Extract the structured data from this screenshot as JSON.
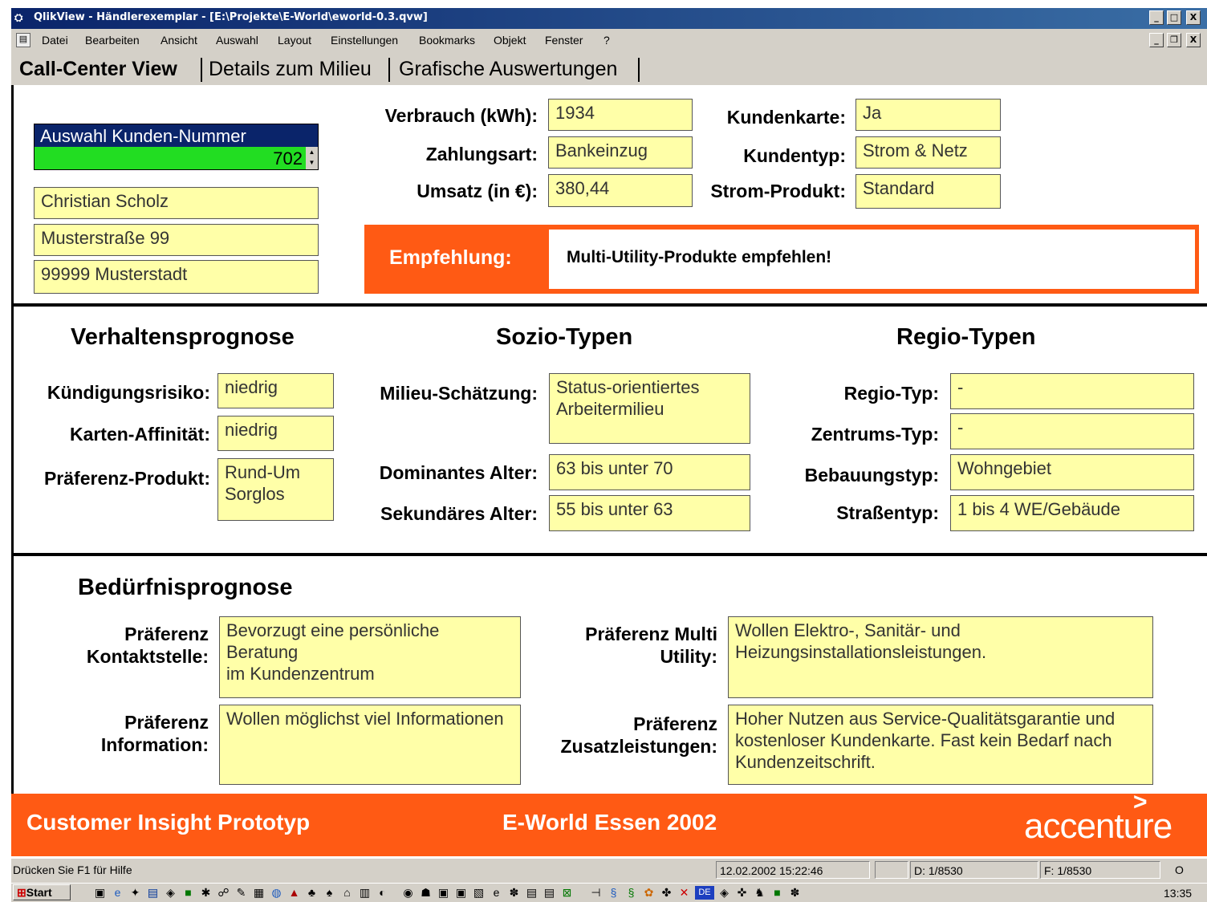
{
  "window": {
    "title": "QlikView - Händlerexemplar - [E:\\Projekte\\E-World\\eworld-0.3.qvw]",
    "min_glyph": "_",
    "max_glyph": "□",
    "restore_glyph": "❐",
    "close_glyph": "X"
  },
  "menu": [
    "Datei",
    "Bearbeiten",
    "Ansicht",
    "Auswahl",
    "Layout",
    "Einstellungen",
    "Bookmarks",
    "Objekt",
    "Fenster",
    "?"
  ],
  "tabs": [
    "Call-Center View",
    "Details zum Milieu",
    "Grafische Auswertungen"
  ],
  "selector": {
    "title": "Auswahl Kunden-Nummer",
    "value": "702"
  },
  "customer": {
    "name": "Christian Scholz",
    "street": "Musterstraße 99",
    "city": "99999 Musterstadt"
  },
  "stats": {
    "verbrauch_label": "Verbrauch (kWh):",
    "verbrauch_value": "1934",
    "zahlungsart_label": "Zahlungsart:",
    "zahlungsart_value": "Bankeinzug",
    "umsatz_label": "Umsatz (in €):",
    "umsatz_value": "380,44",
    "kundenkarte_label": "Kundenkarte:",
    "kundenkarte_value": "Ja",
    "kundentyp_label": "Kundentyp:",
    "kundentyp_value": "Strom & Netz",
    "produkt_label": "Strom-Produkt:",
    "produkt_value": "Standard"
  },
  "empfehlung": {
    "label": "Empfehlung:",
    "text": "Multi-Utility-Produkte empfehlen!"
  },
  "verhalten": {
    "title": "Verhaltensprognose",
    "kuendigung_label": "Kündigungsrisiko:",
    "kuendigung_value": "niedrig",
    "karten_label": "Karten-Affinität:",
    "karten_value": "niedrig",
    "praeferenz_label": "Präferenz-Produkt:",
    "praeferenz_value": "Rund-Um Sorglos"
  },
  "sozio": {
    "title": "Sozio-Typen",
    "milieu_label": "Milieu-Schätzung:",
    "milieu_value": "Status-orientiertes Arbeitermilieu",
    "dom_label": "Dominantes Alter:",
    "dom_value": "63 bis unter 70",
    "sek_label": "Sekundäres Alter:",
    "sek_value": "55 bis unter 63"
  },
  "regio": {
    "title": "Regio-Typen",
    "regio_label": "Regio-Typ:",
    "regio_value": "-",
    "zentrum_label": "Zentrums-Typ:",
    "zentrum_value": "-",
    "bebauung_label": "Bebauungstyp:",
    "bebauung_value": "Wohngebiet",
    "strasse_label": "Straßentyp:",
    "strasse_value": "1 bis 4 WE/Gebäude"
  },
  "beduerfnis": {
    "title": "Bedürfnisprognose",
    "kontakt_label_1": "Präferenz",
    "kontakt_label_2": "Kontaktstelle:",
    "kontakt_value_1": "Bevorzugt eine persönliche",
    "kontakt_value_2": "Beratung",
    "kontakt_value_3": "im Kundenzentrum",
    "info_label_1": "Präferenz",
    "info_label_2": "Information:",
    "info_value": "Wollen möglichst viel Informationen",
    "multi_label_1": "Präferenz Multi",
    "multi_label_2": "Utility:",
    "multi_value_1": "Wollen Elektro-, Sanitär- und",
    "multi_value_2": "Heizungsinstallationsleistungen.",
    "zusatz_label_1": "Präferenz",
    "zusatz_label_2": "Zusatzleistungen:",
    "zusatz_value_1": "Hoher Nutzen aus Service-Qualitätsgarantie und",
    "zusatz_value_2": "kostenloser Kundenkarte. Fast kein Bedarf nach",
    "zusatz_value_3": "Kundenzeitschrift."
  },
  "footer": {
    "left": "Customer Insight Prototyp",
    "center": "E-World Essen 2002",
    "logo_chevron": ">",
    "logo": "accenture"
  },
  "statusbar": {
    "help": "Drücken Sie F1 für Hilfe",
    "datetime": "12.02.2002 15:22:46",
    "d": "D: 1/8530",
    "f": "F: 1/8530",
    "indicator": "O"
  },
  "taskbar": {
    "start": "Start",
    "clock": "13:35",
    "lang": "DE"
  },
  "colors": {
    "accent": "#ff5a14",
    "field": "#ffffa8",
    "selector_bg": "#0a246a",
    "selector_value_bg": "#22dd22"
  }
}
